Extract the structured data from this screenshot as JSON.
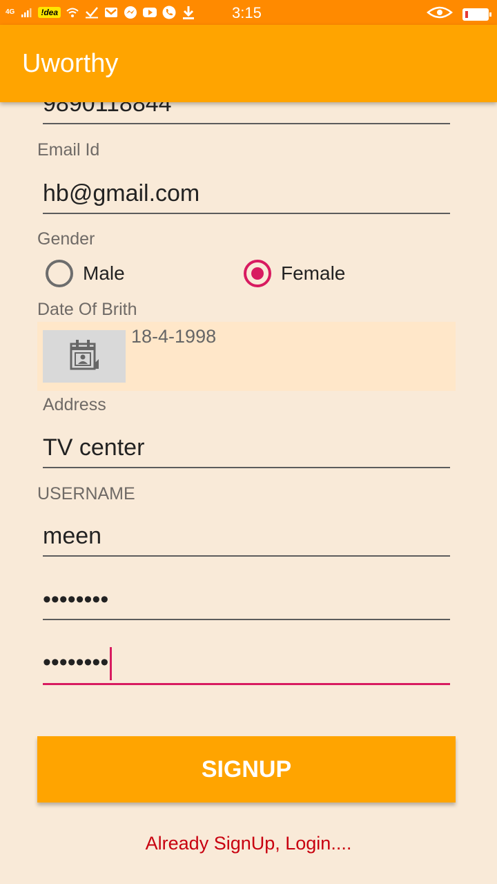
{
  "status_bar": {
    "network": "4G",
    "carrier": "!dea",
    "time": "3:15",
    "battery_level": 0.12,
    "battery_color": "#e53935",
    "icons": [
      "signal-icon",
      "wifi-icon",
      "check-icon",
      "gmail-icon",
      "messenger-icon",
      "youtube-icon",
      "phone-icon",
      "download-icon",
      "eye-icon",
      "battery-icon"
    ]
  },
  "app_bar": {
    "title": "Uworthy",
    "color": "#ffa400"
  },
  "form": {
    "phone_value": "9890118844",
    "email": {
      "label": "Email Id",
      "value": "hb@gmail.com"
    },
    "gender": {
      "label": "Gender",
      "options": [
        {
          "label": "Male",
          "selected": false
        },
        {
          "label": "Female",
          "selected": true
        }
      ]
    },
    "dob": {
      "label": "Date Of Brith",
      "value": "18-4-1998",
      "icon": "calendar-icon"
    },
    "address": {
      "label": "Address",
      "value": "TV center"
    },
    "username": {
      "label": "USERNAME",
      "value": "meen"
    },
    "password": {
      "value": "••••••••"
    },
    "confirm_password": {
      "value": "••••••••"
    }
  },
  "signup_button": {
    "label": "SIGNUP"
  },
  "login_link": {
    "label": "Already SignUp, Login...."
  },
  "colors": {
    "accent": "#d81b60",
    "background": "#f9ead8",
    "status_bar": "#ff8a00"
  }
}
